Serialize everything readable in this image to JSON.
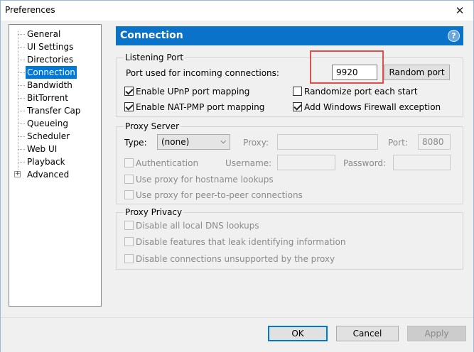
{
  "window": {
    "title": "Preferences",
    "close_glyph": "✕"
  },
  "sidebar": {
    "items": [
      {
        "label": "General"
      },
      {
        "label": "UI Settings"
      },
      {
        "label": "Directories"
      },
      {
        "label": "Connection",
        "selected": true
      },
      {
        "label": "Bandwidth"
      },
      {
        "label": "BitTorrent"
      },
      {
        "label": "Transfer Cap"
      },
      {
        "label": "Queueing"
      },
      {
        "label": "Scheduler"
      },
      {
        "label": "Web UI"
      },
      {
        "label": "Playback"
      },
      {
        "label": "Advanced",
        "expander": "+"
      }
    ]
  },
  "header": {
    "title": "Connection",
    "help_glyph": "?"
  },
  "listening_port": {
    "title": "Listening Port",
    "port_label": "Port used for incoming connections:",
    "port_value": "9920",
    "random_button": "Random port",
    "upnp": {
      "label": "Enable UPnP port mapping",
      "checked": true
    },
    "natpmp": {
      "label": "Enable NAT-PMP port mapping",
      "checked": true
    },
    "randomize": {
      "label": "Randomize port each start",
      "checked": false
    },
    "firewall": {
      "label": "Add Windows Firewall exception",
      "checked": true
    }
  },
  "proxy_server": {
    "title": "Proxy Server",
    "type_label": "Type:",
    "type_value": "(none)",
    "proxy_label": "Proxy:",
    "proxy_value": "",
    "port_label": "Port:",
    "port_value": "8080",
    "auth": {
      "label": "Authentication",
      "checked": false
    },
    "username_label": "Username:",
    "password_label": "Password:",
    "hostname": {
      "label": "Use proxy for hostname lookups",
      "checked": false
    },
    "p2p": {
      "label": "Use proxy for peer-to-peer connections",
      "checked": false
    }
  },
  "proxy_privacy": {
    "title": "Proxy Privacy",
    "dns": {
      "label": "Disable all local DNS lookups",
      "checked": false
    },
    "leak": {
      "label": "Disable features that leak identifying information",
      "checked": false
    },
    "unsupported": {
      "label": "Disable connections unsupported by the proxy",
      "checked": false
    }
  },
  "footer": {
    "ok": "OK",
    "cancel": "Cancel",
    "apply": "Apply"
  },
  "colors": {
    "accent": "#0a72c8",
    "highlight": "#e0504a",
    "selected": "#0078d7"
  }
}
